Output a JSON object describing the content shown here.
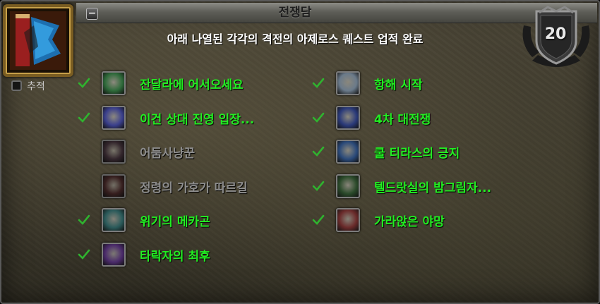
{
  "header": {
    "title": "전쟁담",
    "collapse_symbol": "−"
  },
  "achievement": {
    "icon": "banner-icon",
    "description": "아래 나열된 각각의 격전의 아제로스 퀘스트 업적 완료",
    "points": "20",
    "track_label": "추적"
  },
  "criteria": [
    {
      "label": "잔달라에 어서오세요",
      "completed": true,
      "icon": "zandalar-emblem-icon",
      "color": "#2e6a3a"
    },
    {
      "label": "이건 상대 진영 입장...",
      "completed": true,
      "icon": "alliance-soldier-icon",
      "color": "#3a3f8c"
    },
    {
      "label": "어둠사냥꾼",
      "completed": false,
      "icon": "shadow-hunter-icon",
      "color": "#4a2a3a"
    },
    {
      "label": "정령의 가호가 따르길",
      "completed": false,
      "icon": "spirit-mask-icon",
      "color": "#5a2020"
    },
    {
      "label": "위기의 메카곤",
      "completed": true,
      "icon": "mechagon-gear-icon",
      "color": "#2a5a5a"
    },
    {
      "label": "타락자의 최후",
      "completed": true,
      "icon": "corrupted-eye-icon",
      "color": "#4a2a6a"
    },
    {
      "label": "항해 시작",
      "completed": true,
      "icon": "ship-sail-icon",
      "color": "#6a7a8a"
    },
    {
      "label": "4차 대전쟁",
      "completed": true,
      "icon": "war-shield-icon",
      "color": "#2a3a7a"
    },
    {
      "label": "쿨 티라스의 긍지",
      "completed": true,
      "icon": "kul-tiras-blade-icon",
      "color": "#2a4a7a"
    },
    {
      "label": "텔드랏실의 밤그림자...",
      "completed": true,
      "icon": "teldrassil-shadow-icon",
      "color": "#2a4a2a"
    },
    {
      "label": "가라앉은 야망",
      "completed": true,
      "icon": "sunken-ambition-icon",
      "color": "#6a2a2a"
    }
  ],
  "colors": {
    "completed": "#22ee22",
    "incomplete": "#8d8d8d",
    "check": "#2fb32f"
  }
}
